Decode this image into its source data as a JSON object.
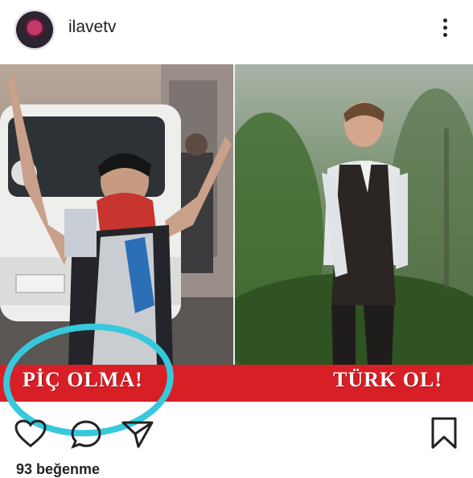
{
  "post": {
    "username": "ilavetv",
    "banner_left": "PİÇ OLMA!",
    "banner_right": "TÜRK OL!",
    "likes_text": "93 beğenme"
  },
  "icons": {
    "avatar": "profile-avatar",
    "more": "more-options-icon",
    "like": "heart-icon",
    "comment": "comment-icon",
    "share": "send-icon",
    "save": "bookmark-icon"
  },
  "colors": {
    "banner": "#d91f26",
    "annotation_circle": "#36c9dd",
    "text": "#222222"
  }
}
